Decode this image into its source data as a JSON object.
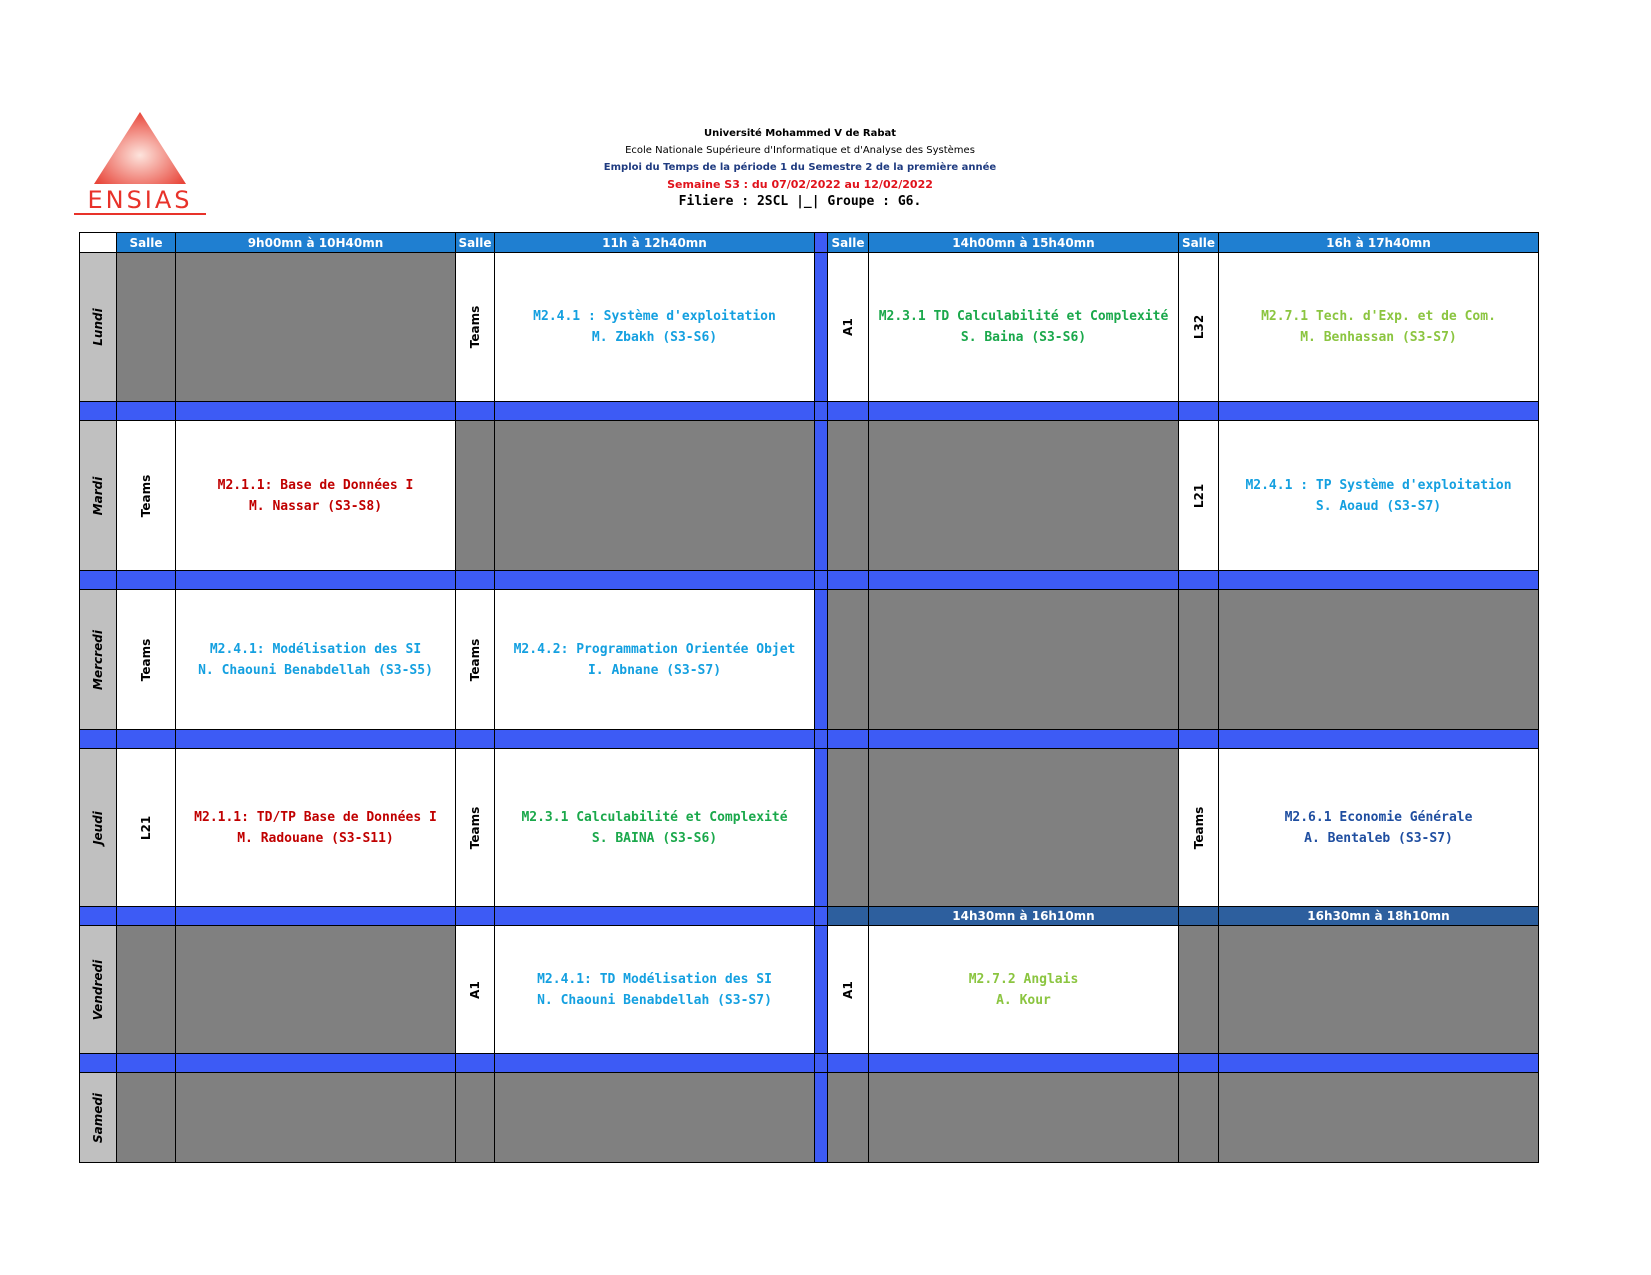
{
  "logo": {
    "text": "ENSIAS"
  },
  "header": {
    "university": "Université Mohammed V de Rabat",
    "school": "Ecole Nationale Supérieure d'Informatique et d'Analyse des Systèmes",
    "emploi": "Emploi du Temps de la période 1 du Semestre 2 de la première année",
    "week": "Semaine S3 : du 07/02/2022 au 12/02/2022",
    "filiere": "Filiere : 2SCL |_| Groupe : G6."
  },
  "columns": {
    "salle": "Salle",
    "slot1": "9h00mn à 10H40mn",
    "slot2": "11h à 12h40mn",
    "slot3": "14h00mn à 15h40mn",
    "slot4": "16h à 17h40mn",
    "slot3_friday": "14h30mn à 16h10mn",
    "slot4_friday": "16h30mn à 18h10mn"
  },
  "days": {
    "lundi": {
      "name": "Lundi",
      "s2": {
        "salle": "Teams",
        "title": "M2.4.1 : Système d'exploitation",
        "teacher": "M. Zbakh (S3-S6)"
      },
      "s3": {
        "salle": "A1",
        "title": "M2.3.1 TD Calculabilité et Complexité",
        "teacher": "S. Baina (S3-S6)"
      },
      "s4": {
        "salle": "L32",
        "title": "M2.7.1 Tech. d'Exp. et de Com.",
        "teacher": "M. Benhassan (S3-S7)"
      }
    },
    "mardi": {
      "name": "Mardi",
      "s1": {
        "salle": "Teams",
        "title": "M2.1.1: Base de Données I",
        "teacher": "M. Nassar (S3-S8)"
      },
      "s4": {
        "salle": "L21",
        "title": "M2.4.1 : TP Système d'exploitation",
        "teacher": "S. Aoaud (S3-S7)"
      }
    },
    "mercredi": {
      "name": "Mercredi",
      "s1": {
        "salle": "Teams",
        "title": "M2.4.1: Modélisation des SI",
        "teacher": "N. Chaouni Benabdellah (S3-S5)"
      },
      "s2": {
        "salle": "Teams",
        "title": "M2.4.2: Programmation Orientée Objet",
        "teacher": "I. Abnane (S3-S7)"
      }
    },
    "jeudi": {
      "name": "Jeudi",
      "s1": {
        "salle": "L21",
        "title": "M2.1.1: TD/TP Base de Données I",
        "teacher": "M. Radouane (S3-S11)"
      },
      "s2": {
        "salle": "Teams",
        "title": "M2.3.1 Calculabilité et Complexité",
        "teacher": "S. BAINA (S3-S6)"
      },
      "s4": {
        "salle": "Teams",
        "title": "M2.6.1 Economie Générale",
        "teacher": "A. Bentaleb (S3-S7)"
      }
    },
    "vendredi": {
      "name": "Vendredi",
      "s2": {
        "salle": "A1",
        "title": "M2.4.1: TD Modélisation des SI",
        "teacher": "N. Chaouni Benabdellah (S3-S7)"
      },
      "s3": {
        "salle": "A1",
        "title": "M2.7.2 Anglais",
        "teacher": "A. Kour"
      }
    },
    "samedi": {
      "name": "Samedi"
    }
  },
  "colors": {
    "header_blue": "#1f7fd1",
    "separator_blue": "#3d5bf5",
    "empty_gray": "#808080",
    "day_gray": "#c0c0c0",
    "cyan": "#14a0e0",
    "green": "#1aa84b",
    "lime": "#8bc540",
    "red": "#c00000",
    "navy": "#1f4ea0",
    "logo_red": "#e8322a"
  }
}
